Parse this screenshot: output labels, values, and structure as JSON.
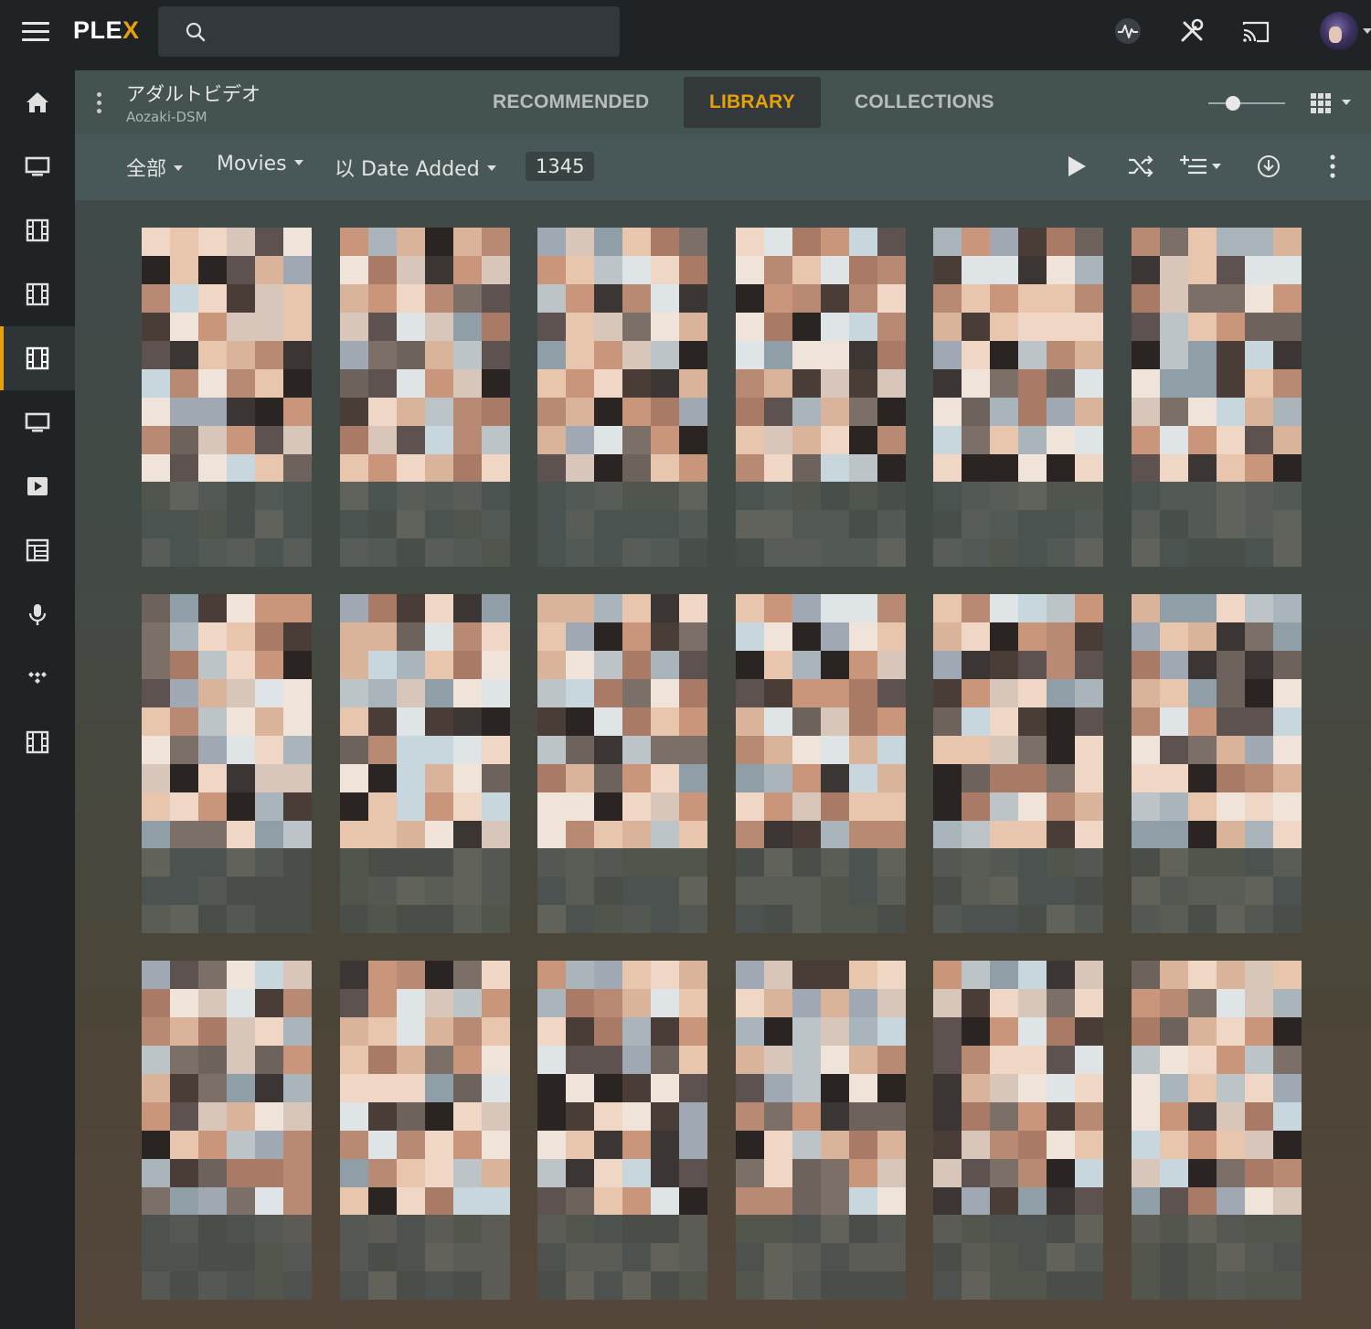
{
  "app": {
    "logo_text": "PLE",
    "logo_x": "X",
    "accent_color": "#e5a00d"
  },
  "search": {
    "placeholder": "",
    "value": ""
  },
  "top_icons": [
    "activity-icon",
    "settings-wrench-icon",
    "cast-icon"
  ],
  "sidebar": {
    "items": [
      {
        "icon": "home-icon"
      },
      {
        "icon": "tv-icon"
      },
      {
        "icon": "film-icon"
      },
      {
        "icon": "film-icon"
      },
      {
        "icon": "film-icon",
        "active": true
      },
      {
        "icon": "tv-icon"
      },
      {
        "icon": "play-icon"
      },
      {
        "icon": "playlist-icon"
      },
      {
        "icon": "microphone-icon"
      },
      {
        "icon": "tidal-icon"
      },
      {
        "icon": "film-icon"
      }
    ]
  },
  "library": {
    "title": "アダルトビデオ",
    "server": "Aozaki-DSM",
    "tabs": [
      {
        "label": "RECOMMENDED"
      },
      {
        "label": "LIBRARY",
        "active": true
      },
      {
        "label": "COLLECTIONS"
      }
    ]
  },
  "toolbar": {
    "filter_all": "全部",
    "type": "Movies",
    "sort": "以 Date Added",
    "count": "1345"
  },
  "posters": {
    "rows": 3,
    "columns": 6,
    "pixelated": true
  }
}
